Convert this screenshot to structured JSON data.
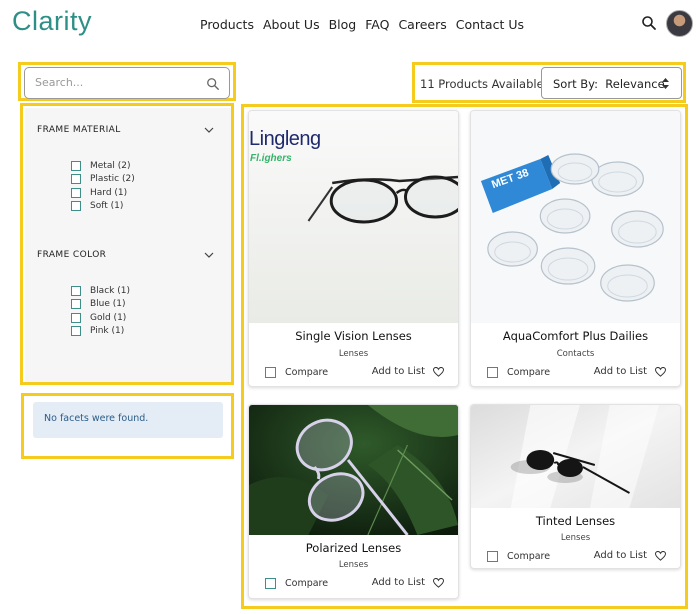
{
  "header": {
    "logo": "Clarity",
    "nav": [
      "Products",
      "About Us",
      "Blog",
      "FAQ",
      "Careers",
      "Contact Us"
    ]
  },
  "search": {
    "placeholder": "Search..."
  },
  "facets": {
    "groups": [
      {
        "title": "FRAME MATERIAL",
        "options": [
          {
            "label": "Metal (2)"
          },
          {
            "label": "Plastic (2)"
          },
          {
            "label": "Hard (1)"
          },
          {
            "label": "Soft (1)"
          }
        ]
      },
      {
        "title": "FRAME COLOR",
        "options": [
          {
            "label": "Black (1)"
          },
          {
            "label": "Blue (1)"
          },
          {
            "label": "Gold (1)"
          },
          {
            "label": "Pink (1)"
          }
        ]
      }
    ],
    "empty_message": "No facets were found."
  },
  "toolbar": {
    "count_text": "11 Products Available",
    "sort_label": "Sort By:",
    "sort_value": "Relevance"
  },
  "products": [
    {
      "name": "Single Vision Lenses",
      "category": "Lenses",
      "compare_label": "Compare",
      "add_label": "Add to List",
      "brand_text": "Lingleng",
      "brand_sub": "Fl.ighers"
    },
    {
      "name": "AquaComfort Plus Dailies",
      "category": "Contacts",
      "compare_label": "Compare",
      "add_label": "Add to List",
      "box_text": "MET 38"
    },
    {
      "name": "Polarized Lenses",
      "category": "Lenses",
      "compare_label": "Compare",
      "add_label": "Add to List"
    },
    {
      "name": "Tinted Lenses",
      "category": "Lenses",
      "compare_label": "Compare",
      "add_label": "Add to List"
    }
  ],
  "colors": {
    "brand": "#2e8f86",
    "highlight": "#f5cb1d",
    "info_bg": "#e4ecf5",
    "info_text": "#2a5d8a"
  }
}
